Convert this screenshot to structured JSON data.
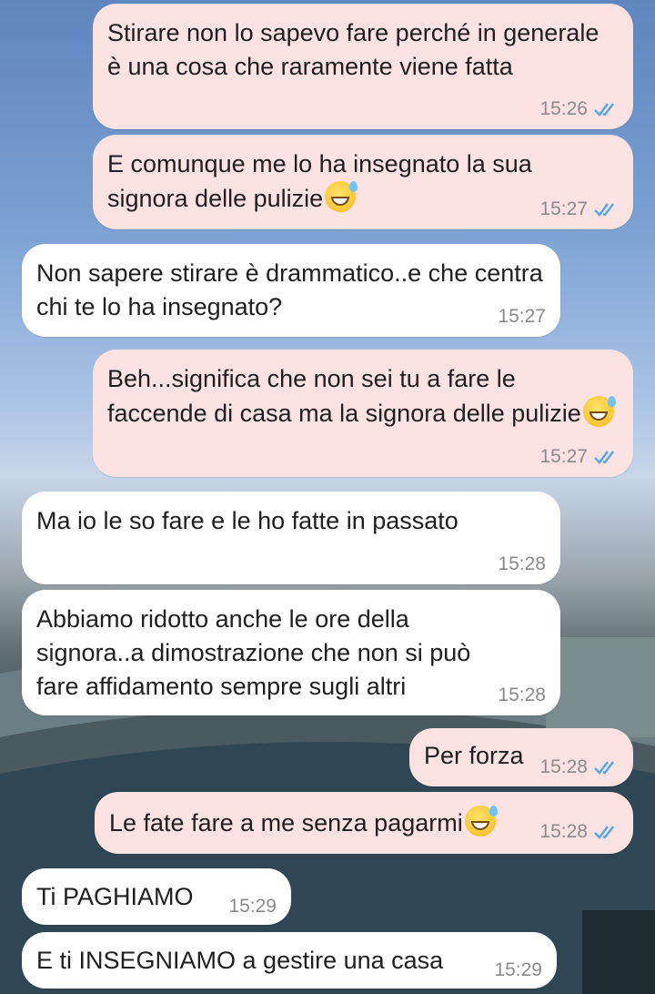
{
  "colors": {
    "outgoing": "#fde2e2",
    "incoming": "#ffffff",
    "ticks": "#4fa8e8",
    "time": "#8a8a8a"
  },
  "messages": [
    {
      "text": "Stirare non lo sapevo fare perché in generale è una cosa che raramente viene fatta",
      "time": "15:26",
      "dir": "out"
    },
    {
      "text": "E comunque me lo ha insegnato la sua signora delle pulizie",
      "time": "15:27",
      "dir": "out",
      "emoji": "sweat-smile-emoji"
    },
    {
      "text": "Non sapere stirare è drammatico..e che centra chi te lo ha insegnato?",
      "time": "15:27",
      "dir": "in"
    },
    {
      "text": "Beh...significa che non sei tu a fare le faccende di casa ma la signora delle pulizie",
      "time": "15:27",
      "dir": "out",
      "emoji": "sweat-smile-emoji"
    },
    {
      "text": "Ma io le so fare e le ho fatte in passato",
      "time": "15:28",
      "dir": "in"
    },
    {
      "text": "Abbiamo ridotto anche le ore della signora..a dimostrazione che non si può fare affidamento sempre sugli altri",
      "time": "15:28",
      "dir": "in"
    },
    {
      "text": "Per forza",
      "time": "15:28",
      "dir": "out"
    },
    {
      "text": "Le fate fare a me senza pagarmi",
      "time": "15:28",
      "dir": "out",
      "emoji": "sweat-smile-emoji"
    },
    {
      "text": "Ti PAGHIAMO",
      "time": "15:29",
      "dir": "in"
    },
    {
      "text": "E ti INSEGNIAMO a gestire una casa",
      "time": "15:29",
      "dir": "in"
    }
  ]
}
